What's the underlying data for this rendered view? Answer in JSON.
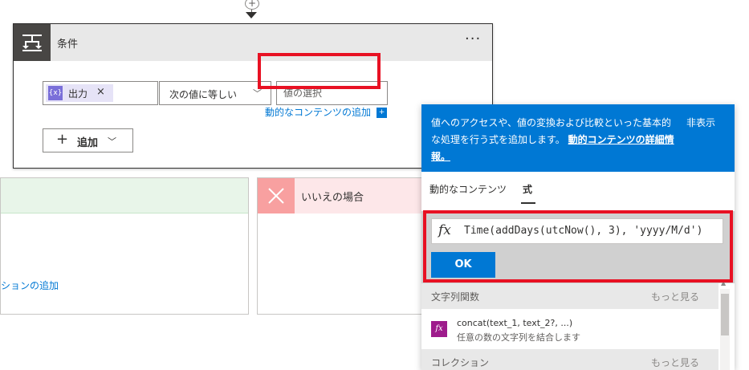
{
  "connector": {
    "plus": "+"
  },
  "condition": {
    "title": "条件",
    "more": "···",
    "token": {
      "icon": "{x}",
      "label": "出力",
      "remove": "×"
    },
    "operator": {
      "value": "次の値に等しい",
      "chevron": "﹀"
    },
    "value_placeholder": "値の選択",
    "dynamic_link": "動的なコンテンツの追加",
    "dynamic_badge": "+",
    "add_button": {
      "plus": "+",
      "label": "追加",
      "chevron": "﹀"
    }
  },
  "yes_branch": {
    "add_action": "ションの追加",
    "color": "#e8f5e9"
  },
  "no_branch": {
    "title": "いいえの場合",
    "color": "#fde7e9"
  },
  "panel": {
    "description": "値へのアクセスや、値の変換および比較といった基本的な処理を行う式を追加します。",
    "learn_more": "動的コンテンツの詳細情報。",
    "hide": "非表示",
    "tabs": [
      {
        "label": "動的なコンテンツ",
        "selected": false
      },
      {
        "label": "式",
        "selected": true
      }
    ],
    "expression": {
      "fx": "fx",
      "value": "Time(addDays(utcNow(), 3), 'yyyy/M/d')"
    },
    "ok_label": "OK",
    "sections": [
      {
        "title": "文字列関数",
        "more": "もっと見る",
        "items": [
          {
            "icon": "fx",
            "name": "concat(text_1, text_2?, ...)",
            "desc": "任意の数の文字列を結合します"
          }
        ]
      },
      {
        "title": "コレクション",
        "more": "もっと見る"
      }
    ],
    "accent": "#0078d4"
  },
  "highlight_color": "#e81123"
}
